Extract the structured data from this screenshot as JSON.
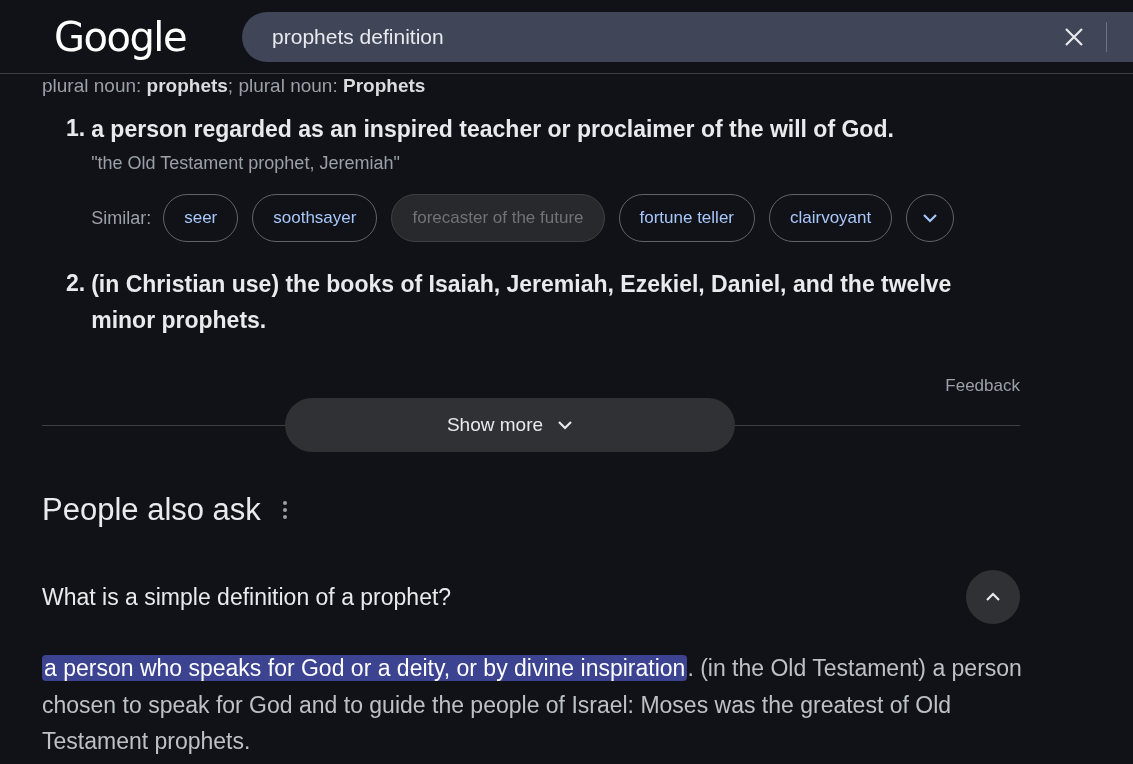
{
  "header": {
    "logo": "Google",
    "search": {
      "value": "prophets definition"
    }
  },
  "definition": {
    "plural_line": "plural noun: **prophets**; plural noun: **Prophets**",
    "senses": [
      {
        "number": "1.",
        "text": "a person regarded as an inspired teacher or proclaimer of the will of God.",
        "example": "\"the Old Testament prophet, Jeremiah\"",
        "similar_label": "Similar:",
        "similar": [
          {
            "label": "seer",
            "disabled": false
          },
          {
            "label": "soothsayer",
            "disabled": false
          },
          {
            "label": "forecaster of the future",
            "disabled": true
          },
          {
            "label": "fortune teller",
            "disabled": false
          },
          {
            "label": "clairvoyant",
            "disabled": false
          }
        ]
      },
      {
        "number": "2.",
        "text": "(in Christian use) the books of Isaiah, Jeremiah, Ezekiel, Daniel, and the twelve minor prophets."
      }
    ],
    "feedback": "Feedback",
    "show_more": "Show more"
  },
  "people_also_ask": {
    "title": "People also ask",
    "questions": [
      {
        "question": "What is a simple definition of a prophet?",
        "expanded": true,
        "answer_highlight": "a person who speaks for God or a deity, or by divine inspiration",
        "answer_rest": ". (in the Old Testament) a person chosen to speak for God and to guide the people of Israel: Moses was the greatest of Old Testament prophets."
      }
    ]
  }
}
